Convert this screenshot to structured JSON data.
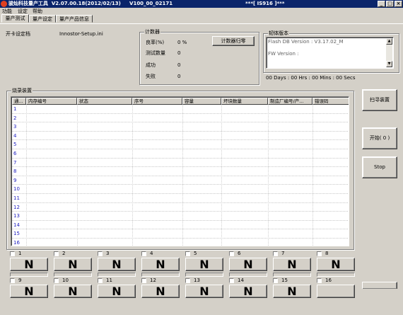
{
  "window": {
    "title": "骏灿科技量产工具  V2.07.00.18(2012/02/13)     V100_00_02171",
    "center_title": "***[ IS916 ]***",
    "min_btn": "_",
    "max_btn": "□",
    "close_btn": "×"
  },
  "menu": [
    "功能",
    "设定",
    "帮助"
  ],
  "tabs": [
    "量产测试",
    "量产设定",
    "量产产品信息"
  ],
  "settings": {
    "label": "开卡设定档",
    "value": "Innostor-Setup.ini"
  },
  "counter": {
    "title": "计数器",
    "yield_label": "良率(%)",
    "yield_value": "0 %",
    "tested_label": "测试数量",
    "tested_value": "0",
    "success_label": "成功",
    "success_value": "0",
    "fail_label": "失败",
    "fail_value": "0",
    "reset_button": "计数器归零"
  },
  "firmware": {
    "title": "韧体版本",
    "flash_db": "Flash DB Version :  V3.17.02_M",
    "fw_version": "FW Version :"
  },
  "timer": "00 Days : 00 Hrs : 00 Mins : 00 Secs",
  "table": {
    "title": "烧录装置",
    "columns": [
      "通...",
      "内存编号",
      "状态",
      "序号",
      "容量",
      "坏块数量",
      "制造厂编号/产...",
      "错误码"
    ],
    "rows": [
      "1",
      "2",
      "3",
      "4",
      "5",
      "6",
      "7",
      "8",
      "9",
      "10",
      "11",
      "12",
      "13",
      "14",
      "15",
      "16"
    ]
  },
  "side_buttons": {
    "scan": "扫寻装置",
    "start": "开始( 0 )",
    "stop": "Stop"
  },
  "slots": [
    {
      "num": "1",
      "state": "N"
    },
    {
      "num": "2",
      "state": "N"
    },
    {
      "num": "3",
      "state": "N"
    },
    {
      "num": "4",
      "state": "N"
    },
    {
      "num": "5",
      "state": "N"
    },
    {
      "num": "6",
      "state": "N"
    },
    {
      "num": "7",
      "state": "N"
    },
    {
      "num": "8",
      "state": "N"
    },
    {
      "num": "9",
      "state": "N"
    },
    {
      "num": "10",
      "state": "N"
    },
    {
      "num": "11",
      "state": "N"
    },
    {
      "num": "12",
      "state": "N"
    },
    {
      "num": "13",
      "state": "N"
    },
    {
      "num": "14",
      "state": "N"
    },
    {
      "num": "15",
      "state": "N"
    },
    {
      "num": "16",
      "state": ""
    }
  ]
}
